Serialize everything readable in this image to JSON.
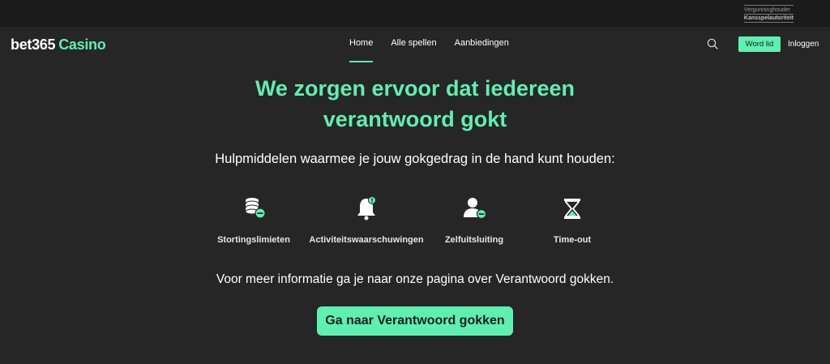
{
  "license": {
    "line1": "Vergunninghouder",
    "line2": "Kansspelautoriteit"
  },
  "brand": {
    "name": "bet365",
    "product": "Casino"
  },
  "nav": {
    "items": [
      {
        "label": "Home",
        "active": true
      },
      {
        "label": "Alle spellen",
        "active": false
      },
      {
        "label": "Aanbiedingen",
        "active": false
      }
    ]
  },
  "header_actions": {
    "join_label": "Word lid",
    "login_label": "Inloggen"
  },
  "hero": {
    "headline_line1": "We zorgen ervoor dat iedereen",
    "headline_line2": "verantwoord gokt",
    "subheading": "Hulpmiddelen waarmee je jouw gokgedrag in de hand kunt houden:"
  },
  "tools": [
    {
      "label": "Stortingslimieten",
      "icon": "coins-limit-icon"
    },
    {
      "label": "Activiteitswaarschuwingen",
      "icon": "bell-alert-icon"
    },
    {
      "label": "Zelfuitsluiting",
      "icon": "user-exclusion-icon"
    },
    {
      "label": "Time-out",
      "icon": "hourglass-icon"
    }
  ],
  "info_text": "Voor meer informatie ga je naar onze pagina over Verantwoord gokken.",
  "cta_label": "Ga naar Verantwoord gokken",
  "colors": {
    "accent": "#5ef0b1",
    "background": "#262626",
    "topbar": "#1b1b1b"
  }
}
